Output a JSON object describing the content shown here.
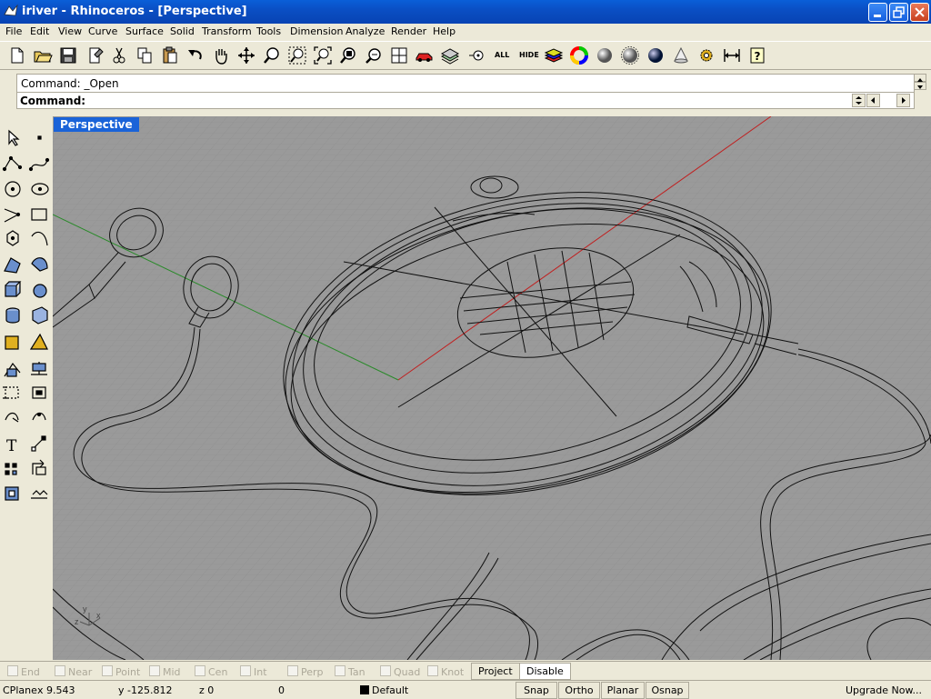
{
  "window": {
    "title": "iriver - Rhinoceros - [Perspective]"
  },
  "menu": [
    "File",
    "Edit",
    "View",
    "Curve",
    "Surface",
    "Solid",
    "Transform",
    "Tools",
    "Dimension",
    "Analyze",
    "Render",
    "Help"
  ],
  "toolbar": {
    "all_label": "ALL",
    "hide_label": "HIDE"
  },
  "command": {
    "history": "Command: _Open",
    "prompt": "Command:",
    "value": ""
  },
  "viewport": {
    "title": "Perspective",
    "axis_x": "x",
    "axis_y": "y",
    "axis_z": "z"
  },
  "osnap": {
    "items": [
      "End",
      "Near",
      "Point",
      "Mid",
      "Cen",
      "Int",
      "Perp",
      "Tan",
      "Quad",
      "Knot"
    ],
    "project_label": "Project",
    "disable_label": "Disable"
  },
  "status": {
    "cplane": "CPlane",
    "x": "x 9.543",
    "y": "y -125.812",
    "z": "z 0",
    "extra": "0",
    "layer": "Default",
    "snap": "Snap",
    "ortho": "Ortho",
    "planar": "Planar",
    "osnap": "Osnap",
    "upgrade": "Upgrade Now..."
  },
  "colors": {
    "xp_blue": "#0a4fc4",
    "viewport_bg": "#9a9a9a",
    "viewport_title": "#1a63d8"
  }
}
